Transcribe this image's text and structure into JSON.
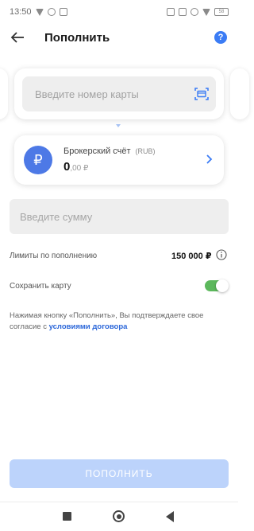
{
  "status_bar": {
    "time": "13:50",
    "battery": "58"
  },
  "header": {
    "title": "Пополнить",
    "help_symbol": "?"
  },
  "card_field": {
    "placeholder": "Введите номер карты"
  },
  "account": {
    "currency_symbol": "₽",
    "name": "Брокерский счёт",
    "currency": "(RUB)",
    "balance_int": "0",
    "balance_dec": ",00 ₽"
  },
  "amount_field": {
    "placeholder": "Введите сумму"
  },
  "limits": {
    "label": "Лимиты по пополнению",
    "value": "150 000 ₽"
  },
  "save_card": {
    "label": "Сохранить карту",
    "enabled": true
  },
  "consent": {
    "text": "Нажимая кнопку «Пополнить», Вы подтверждаете свое согласие с ",
    "link": "условиями договора"
  },
  "submit": {
    "label": "Пополнить"
  },
  "colors": {
    "accent": "#3b7cf5",
    "toggle_on": "#5cb85c",
    "button_disabled": "#bcd3fb",
    "link": "#2a66d9"
  }
}
